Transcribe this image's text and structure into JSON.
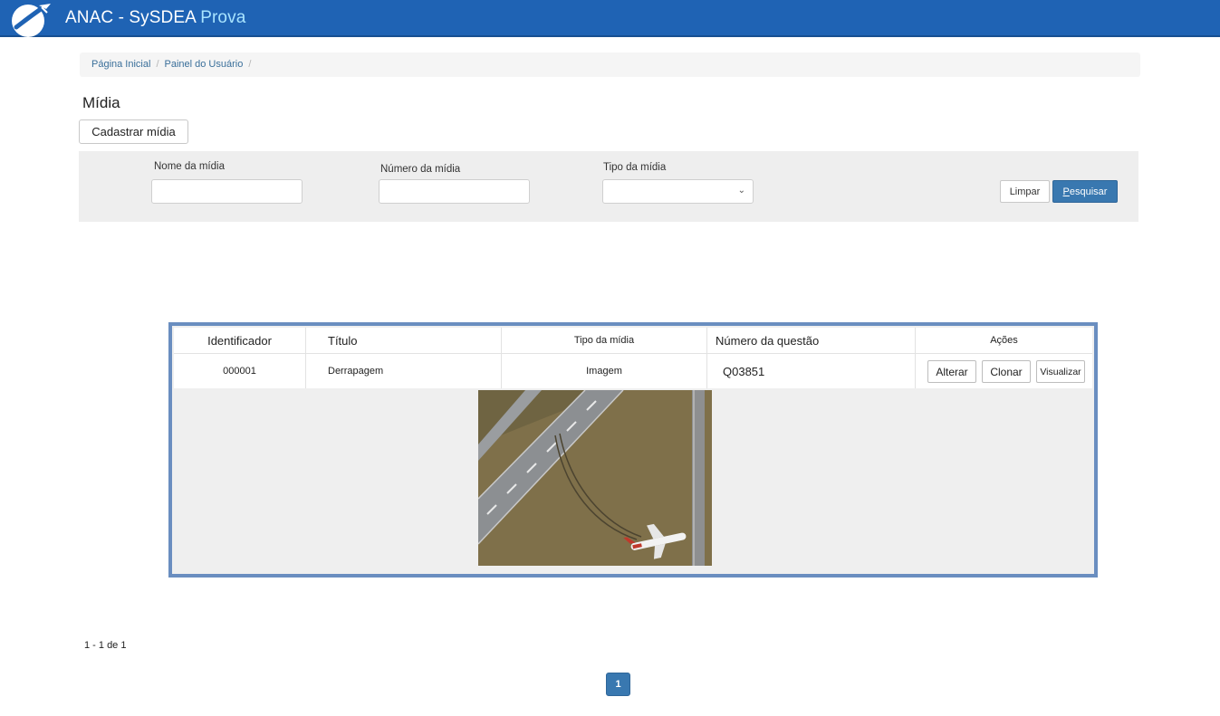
{
  "header": {
    "title_main": "ANAC - SySDEA",
    "title_accent": "Prova",
    "bar_color": "#1f63b4",
    "logo_icon": "airplane-logo-icon"
  },
  "breadcrumb": {
    "items": [
      "Página Inicial",
      "Painel do Usuário"
    ],
    "separator": "/"
  },
  "page": {
    "title": "Mídia",
    "register_button": "Cadastrar mídia"
  },
  "filters": {
    "name_label": "Nome da mídia",
    "number_label": "Número da mídia",
    "type_label": "Tipo da mídia",
    "name_value": "",
    "number_value": "",
    "type_value": "",
    "select_arrow_icon": "chevron-down-icon",
    "clear_button": "Limpar",
    "search_button_first_letter": "P",
    "search_button_rest": "esquisar"
  },
  "table": {
    "headers": [
      "Identificador",
      "Título",
      "Tipo da mídia",
      "Número da questão",
      "Ações"
    ],
    "rows": [
      {
        "id": "000001",
        "title": "Derrapagem",
        "type": "Imagem",
        "question": "Q03851",
        "actions": [
          "Alterar",
          "Clonar",
          "Visualizar"
        ]
      }
    ],
    "preview_icon": "aircraft-runway-excursion-photo"
  },
  "pagination": {
    "count_text": "1 - 1 de 1",
    "current_page": "1",
    "accent_color": "#3978b0"
  }
}
